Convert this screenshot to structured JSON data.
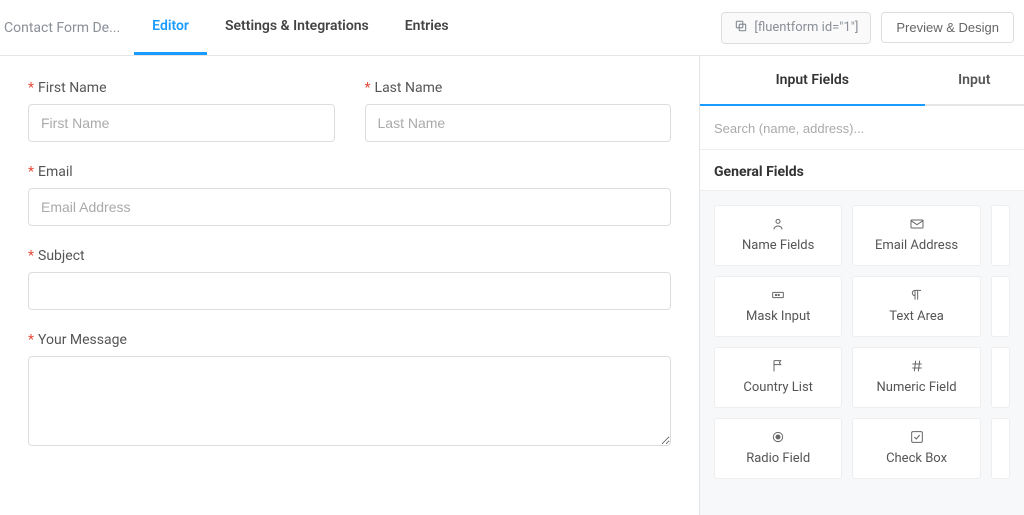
{
  "header": {
    "formName": "Contact Form De...",
    "tabs": [
      {
        "label": "Editor",
        "active": true
      },
      {
        "label": "Settings & Integrations",
        "active": false
      },
      {
        "label": "Entries",
        "active": false
      }
    ],
    "shortcode": "[fluentform id=\"1\"]",
    "previewButton": "Preview & Design"
  },
  "form": {
    "firstName": {
      "label": "First Name",
      "placeholder": "First Name",
      "required": true
    },
    "lastName": {
      "label": "Last Name",
      "placeholder": "Last Name",
      "required": true
    },
    "email": {
      "label": "Email",
      "placeholder": "Email Address",
      "required": true
    },
    "subject": {
      "label": "Subject",
      "placeholder": "",
      "required": true
    },
    "message": {
      "label": "Your Message",
      "placeholder": "",
      "required": true
    }
  },
  "sidebar": {
    "tabs": [
      {
        "label": "Input Fields",
        "active": true
      },
      {
        "label": "Input",
        "active": false
      }
    ],
    "searchPlaceholder": "Search (name, address)...",
    "sectionTitle": "General Fields",
    "fields": [
      {
        "label": "Name Fields",
        "icon": "user"
      },
      {
        "label": "Email Address",
        "icon": "mail"
      },
      {
        "label": "Mask Input",
        "icon": "mask"
      },
      {
        "label": "Text Area",
        "icon": "paragraph"
      },
      {
        "label": "Country List",
        "icon": "flag"
      },
      {
        "label": "Numeric Field",
        "icon": "hash"
      },
      {
        "label": "Radio Field",
        "icon": "radio"
      },
      {
        "label": "Check Box",
        "icon": "check"
      }
    ]
  }
}
